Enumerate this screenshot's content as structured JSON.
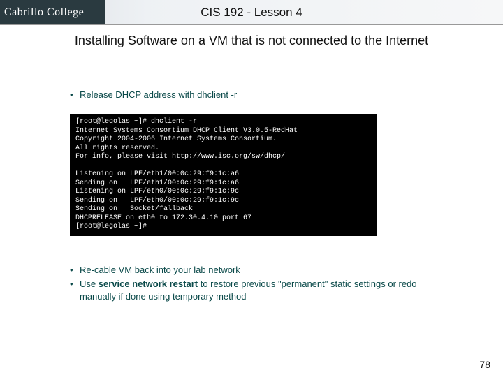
{
  "header": {
    "logo": "Cabrillo College",
    "title": "CIS 192 - Lesson 4"
  },
  "subtitle": "Installing Software on a VM that is not connected to the Internet",
  "bullets": {
    "first_pre": "Release DHCP address with ",
    "first_cmd": "dhclient -r",
    "second": "Re-cable VM back into your lab network",
    "third_pre": "Use ",
    "third_cmd": "service network restart",
    "third_post": " to restore previous \"permanent\" static settings or redo manually if done using temporary method"
  },
  "terminal_lines": [
    "[root@legolas ~]# dhclient -r",
    "Internet Systems Consortium DHCP Client V3.0.5-RedHat",
    "Copyright 2004-2006 Internet Systems Consortium.",
    "All rights reserved.",
    "For info, please visit http://www.isc.org/sw/dhcp/",
    "",
    "Listening on LPF/eth1/00:0c:29:f9:1c:a6",
    "Sending on   LPF/eth1/00:0c:29:f9:1c:a6",
    "Listening on LPF/eth0/00:0c:29:f9:1c:9c",
    "Sending on   LPF/eth0/00:0c:29:f9:1c:9c",
    "Sending on   Socket/fallback",
    "DHCPRELEASE on eth0 to 172.30.4.10 port 67",
    "[root@legolas ~]# _"
  ],
  "page_number": "78"
}
